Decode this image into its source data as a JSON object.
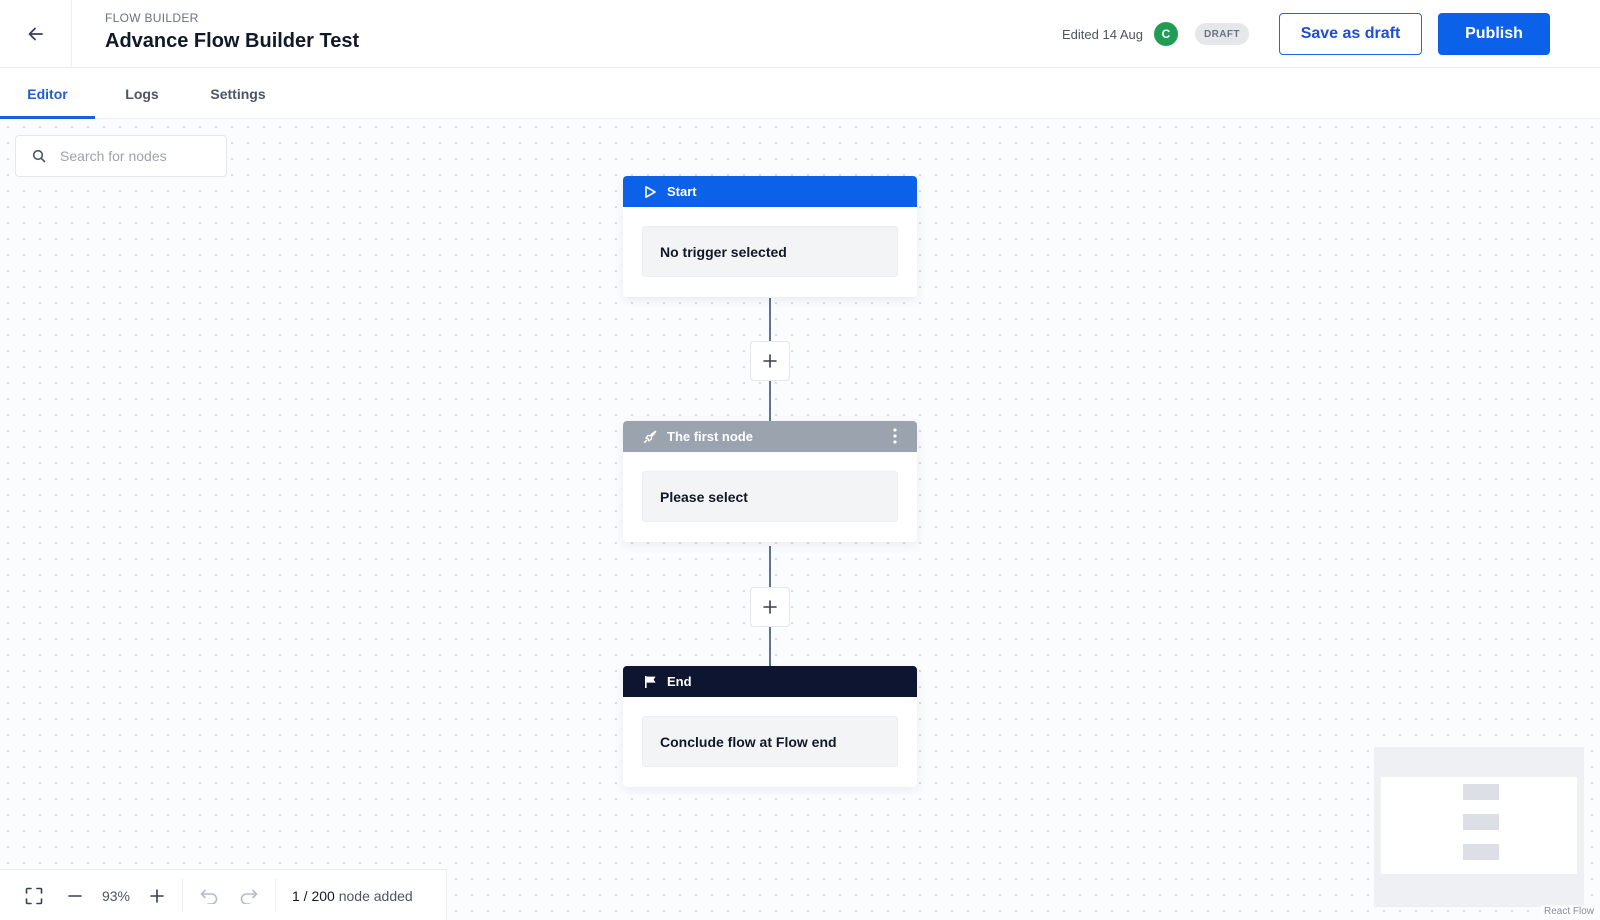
{
  "header": {
    "overline": "FLOW BUILDER",
    "title": "Advance Flow Builder Test",
    "edited": "Edited 14 Aug",
    "avatar_initial": "C",
    "status_badge": "DRAFT",
    "save_draft_label": "Save as draft",
    "publish_label": "Publish"
  },
  "tabs": [
    {
      "label": "Editor",
      "active": true
    },
    {
      "label": "Logs",
      "active": false
    },
    {
      "label": "Settings",
      "active": false
    }
  ],
  "search": {
    "placeholder": "Search for nodes",
    "value": ""
  },
  "nodes": {
    "start": {
      "title": "Start",
      "field": "No trigger selected",
      "icon": "play-icon",
      "color": "#0b62e8"
    },
    "first": {
      "title": "The first node",
      "field": "Please select",
      "icon": "rocket-icon",
      "color": "#9ba3af"
    },
    "end": {
      "title": "End",
      "field": "Conclude flow at Flow end",
      "icon": "flag-icon",
      "color": "#0d1530"
    }
  },
  "controls": {
    "zoom": "93%",
    "node_count_current": "1 / 200",
    "node_count_suffix": " node added"
  },
  "attribution": "React Flow",
  "colors": {
    "accent": "#0b62e8",
    "success": "#1f9d55",
    "connector": "#5b7593"
  }
}
